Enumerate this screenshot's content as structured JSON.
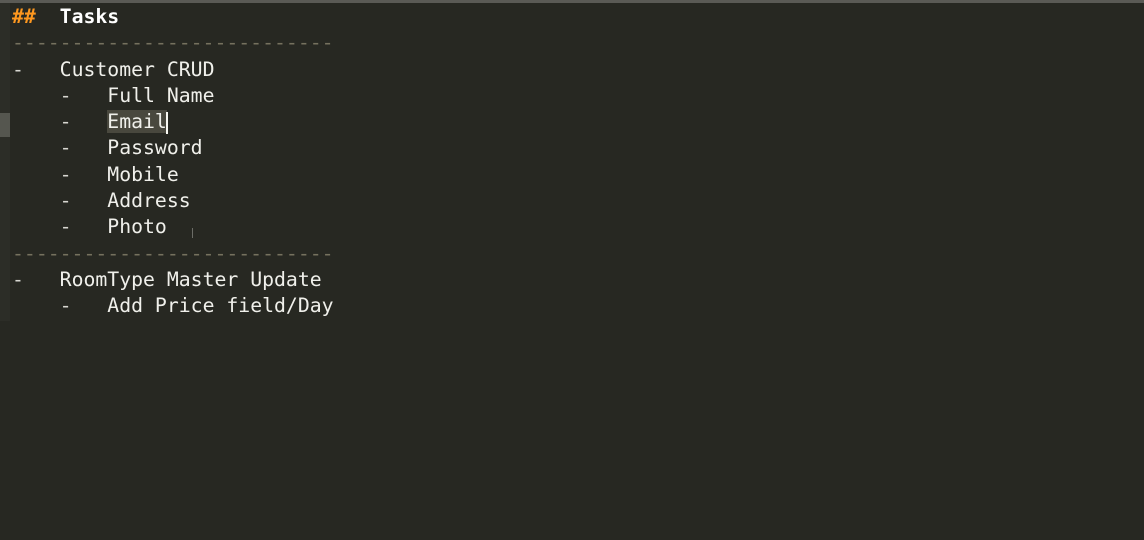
{
  "editor": {
    "heading_marker": "##",
    "heading_text": "Tasks",
    "rule": "---------------------------",
    "bullet": "-",
    "task_1": {
      "title": "Customer CRUD",
      "items": [
        "Full Name",
        "Email",
        "Password",
        "Mobile",
        "Address",
        "Photo"
      ]
    },
    "task_2": {
      "title": "RoomType Master Update",
      "items": [
        "Add Price field/Day"
      ]
    }
  }
}
